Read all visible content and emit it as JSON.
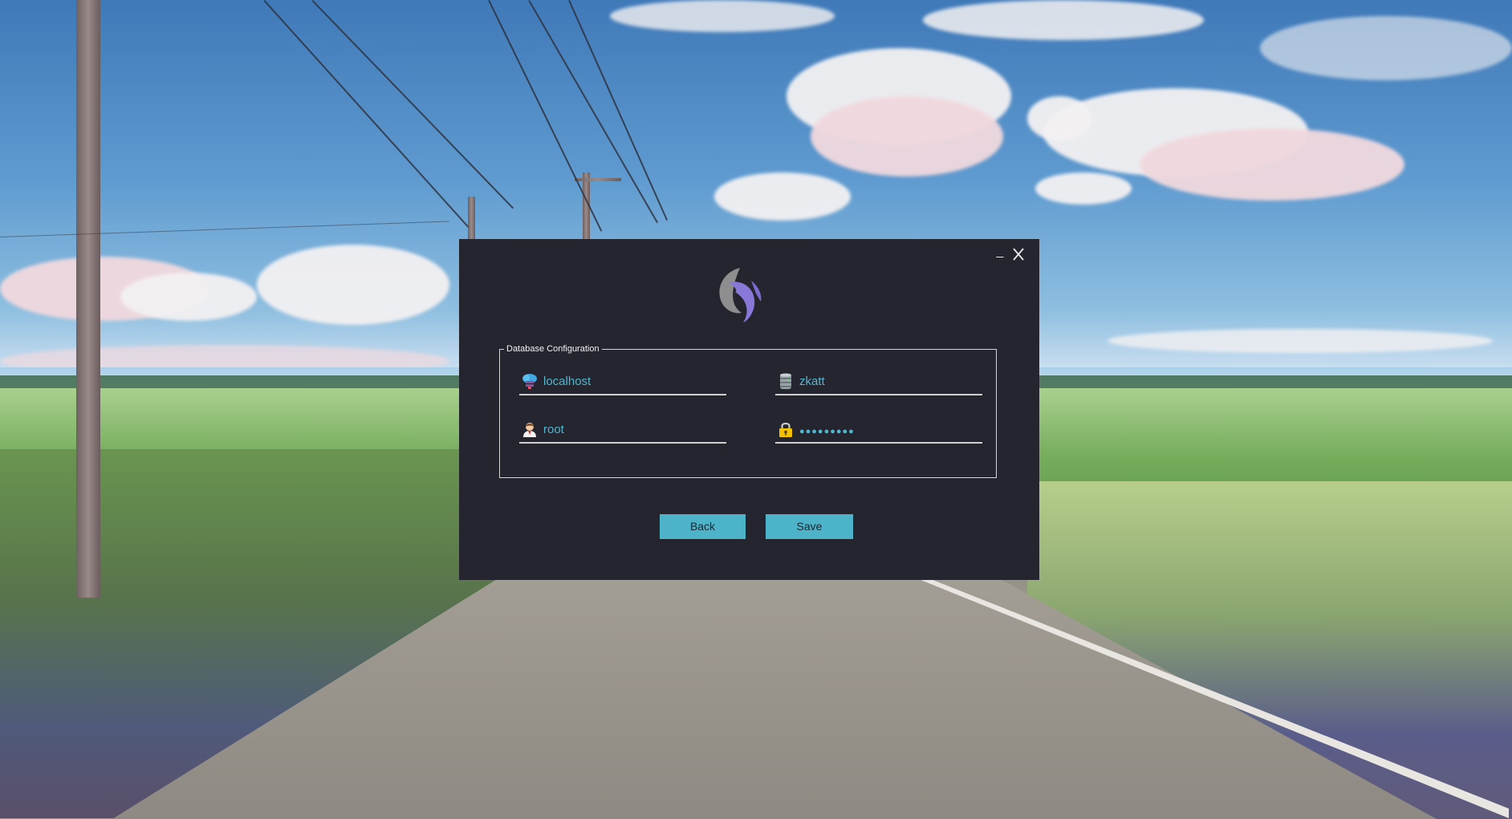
{
  "window": {
    "minimize_label": "_",
    "close_icon": "close-icon"
  },
  "logo": {
    "icon": "app-logo-icon",
    "colors": {
      "grey": "#8e8e8e",
      "purple": "#8a78d8"
    }
  },
  "database_config": {
    "group_title": "Database Configuration",
    "fields": {
      "server": {
        "icon": "cloud-server-icon",
        "value": "localhost"
      },
      "database": {
        "icon": "database-icon",
        "value": "zkatt"
      },
      "username": {
        "icon": "user-icon",
        "value": "root"
      },
      "password": {
        "icon": "lock-icon",
        "value": "●●●●●●●●●"
      }
    }
  },
  "buttons": {
    "back_label": "Back",
    "save_label": "Save"
  },
  "colors": {
    "dialog_background": "#24252f",
    "accent": "#4cb3c9",
    "field_text": "#4fb8d0"
  }
}
